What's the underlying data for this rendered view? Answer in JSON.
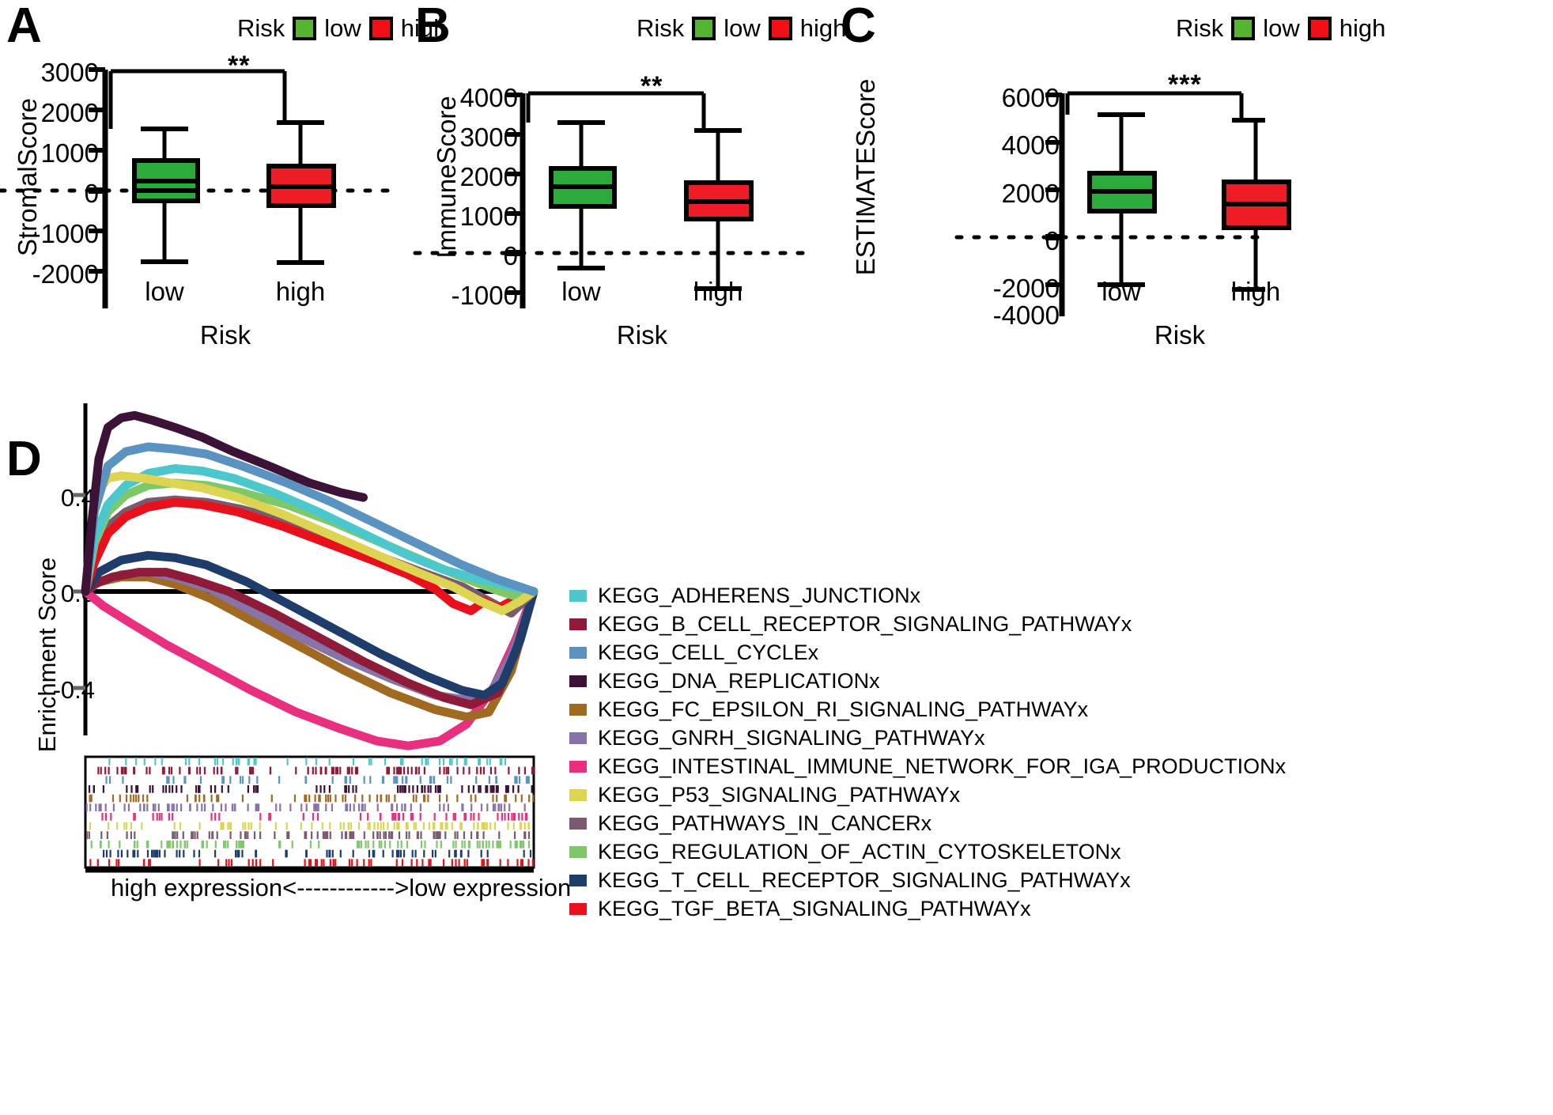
{
  "figure": {
    "panel_letters": [
      "A",
      "B",
      "C",
      "D"
    ]
  },
  "risk_legend": {
    "title": "Risk",
    "items": [
      {
        "label": "low",
        "color": "#55b531"
      },
      {
        "label": "high",
        "color": "#f20f16"
      }
    ]
  },
  "chart_data": [
    {
      "type": "box",
      "panel": "A",
      "title": "",
      "ylabel": "StromalScore",
      "xlabel": "Risk",
      "categories": [
        "low",
        "high"
      ],
      "yticks": [
        3000,
        2000,
        1000,
        0,
        -1000,
        -2000
      ],
      "ylim": [
        -2000,
        3000
      ],
      "significance": "**",
      "zero_reference_line": 0,
      "series": [
        {
          "name": "low",
          "color": "#2caa3c",
          "min": -1730,
          "q1": -20,
          "median": 230,
          "q3": 750,
          "max": 1990
        },
        {
          "name": "high",
          "color": "#ee1c25",
          "min": -1780,
          "q1": -380,
          "median": 110,
          "q3": 600,
          "max": 2080
        }
      ]
    },
    {
      "type": "box",
      "panel": "B",
      "title": "",
      "ylabel": "ImmuneScore",
      "xlabel": "Risk",
      "categories": [
        "low",
        "high"
      ],
      "yticks": [
        4000,
        3000,
        2000,
        1000,
        0,
        -1000
      ],
      "ylim": [
        -1000,
        4000
      ],
      "significance": "**",
      "zero_reference_line": 0,
      "series": [
        {
          "name": "low",
          "color": "#2caa3c",
          "min": -380,
          "q1": 1180,
          "median": 1680,
          "q3": 2130,
          "max": 3220
        },
        {
          "name": "high",
          "color": "#ee1c25",
          "min": -900,
          "q1": 860,
          "median": 1300,
          "q3": 1780,
          "max": 2900
        }
      ]
    },
    {
      "type": "box",
      "panel": "C",
      "title": "",
      "ylabel": "ESTIMATEScore",
      "xlabel": "Risk",
      "categories": [
        "low",
        "high"
      ],
      "yticks": [
        6000,
        4000,
        2000,
        0,
        -2000,
        -4000
      ],
      "ylim": [
        -4000,
        6000
      ],
      "significance": "***",
      "zero_reference_line": 0,
      "series": [
        {
          "name": "low",
          "color": "#2caa3c",
          "min": -2130,
          "q1": 1120,
          "median": 1950,
          "q3": 2700,
          "max": 4900
        },
        {
          "name": "high",
          "color": "#ee1c25",
          "min": -2320,
          "q1": 420,
          "median": 1420,
          "q3": 2320,
          "max": 4650
        }
      ]
    },
    {
      "type": "line",
      "panel": "D",
      "title": "",
      "ylabel": "Enrichment Score",
      "xlabel": "",
      "yticks": [
        0.4,
        0.0,
        -0.4
      ],
      "ytick_labels": [
        "0.4",
        "0.0",
        "-0.4"
      ],
      "ylim": [
        -0.72,
        0.78
      ],
      "xlim": [
        0,
        1
      ],
      "x_axis_caption": "high expression<------------>low expression",
      "legend_position": "right",
      "series": [
        {
          "name": "KEGG_ADHERENS_JUNCTIONx",
          "color": "#4cc8cd",
          "points": [
            [
              0.0,
              0.0
            ],
            [
              0.02,
              0.22
            ],
            [
              0.05,
              0.36
            ],
            [
              0.09,
              0.44
            ],
            [
              0.14,
              0.49
            ],
            [
              0.2,
              0.51
            ],
            [
              0.26,
              0.5
            ],
            [
              0.33,
              0.47
            ],
            [
              0.42,
              0.41
            ],
            [
              0.52,
              0.33
            ],
            [
              0.62,
              0.24
            ],
            [
              0.72,
              0.15
            ],
            [
              0.8,
              0.09
            ],
            [
              0.88,
              0.05
            ],
            [
              0.95,
              0.02
            ],
            [
              1.0,
              0.0
            ]
          ]
        },
        {
          "name": "KEGG_B_CELL_RECEPTOR_SIGNALING_PATHWAYx",
          "color": "#8e1c38",
          "points": [
            [
              0.0,
              0.0
            ],
            [
              0.02,
              0.03
            ],
            [
              0.06,
              0.06
            ],
            [
              0.12,
              0.08
            ],
            [
              0.18,
              0.08
            ],
            [
              0.24,
              0.05
            ],
            [
              0.32,
              0.0
            ],
            [
              0.42,
              -0.09
            ],
            [
              0.52,
              -0.19
            ],
            [
              0.62,
              -0.29
            ],
            [
              0.72,
              -0.38
            ],
            [
              0.8,
              -0.44
            ],
            [
              0.86,
              -0.47
            ],
            [
              0.92,
              -0.42
            ],
            [
              0.96,
              -0.25
            ],
            [
              1.0,
              0.0
            ]
          ]
        },
        {
          "name": "KEGG_CELL_CYCLEx",
          "color": "#5a93c0",
          "points": [
            [
              0.0,
              0.0
            ],
            [
              0.02,
              0.33
            ],
            [
              0.05,
              0.52
            ],
            [
              0.09,
              0.58
            ],
            [
              0.14,
              0.6
            ],
            [
              0.2,
              0.59
            ],
            [
              0.27,
              0.57
            ],
            [
              0.35,
              0.52
            ],
            [
              0.45,
              0.45
            ],
            [
              0.55,
              0.37
            ],
            [
              0.65,
              0.28
            ],
            [
              0.75,
              0.19
            ],
            [
              0.84,
              0.11
            ],
            [
              0.92,
              0.05
            ],
            [
              1.0,
              0.0
            ]
          ]
        },
        {
          "name": "KEGG_DNA_REPLICATIONx",
          "color": "#3c1236",
          "points": [
            [
              0.0,
              0.0
            ],
            [
              0.015,
              0.3
            ],
            [
              0.03,
              0.55
            ],
            [
              0.05,
              0.68
            ],
            [
              0.08,
              0.72
            ],
            [
              0.11,
              0.73
            ],
            [
              0.15,
              0.71
            ],
            [
              0.2,
              0.68
            ],
            [
              0.26,
              0.64
            ],
            [
              0.33,
              0.58
            ],
            [
              0.41,
              0.52
            ],
            [
              0.5,
              0.45
            ],
            [
              0.57,
              0.41
            ],
            [
              0.62,
              0.39
            ]
          ]
        },
        {
          "name": "KEGG_FC_EPSILON_RI_SIGNALING_PATHWAYx",
          "color": "#a06a23",
          "points": [
            [
              0.0,
              0.0
            ],
            [
              0.03,
              0.04
            ],
            [
              0.08,
              0.06
            ],
            [
              0.14,
              0.06
            ],
            [
              0.2,
              0.03
            ],
            [
              0.28,
              -0.03
            ],
            [
              0.38,
              -0.13
            ],
            [
              0.48,
              -0.23
            ],
            [
              0.58,
              -0.33
            ],
            [
              0.68,
              -0.42
            ],
            [
              0.78,
              -0.49
            ],
            [
              0.85,
              -0.52
            ],
            [
              0.9,
              -0.5
            ],
            [
              0.95,
              -0.33
            ],
            [
              1.0,
              0.0
            ]
          ]
        },
        {
          "name": "KEGG_GNRH_SIGNALING_PATHWAYx",
          "color": "#8873a8",
          "points": [
            [
              0.0,
              0.0
            ],
            [
              0.03,
              0.04
            ],
            [
              0.08,
              0.07
            ],
            [
              0.14,
              0.08
            ],
            [
              0.2,
              0.06
            ],
            [
              0.28,
              0.01
            ],
            [
              0.38,
              -0.09
            ],
            [
              0.48,
              -0.19
            ],
            [
              0.58,
              -0.28
            ],
            [
              0.68,
              -0.36
            ],
            [
              0.78,
              -0.43
            ],
            [
              0.85,
              -0.45
            ],
            [
              0.9,
              -0.43
            ],
            [
              0.95,
              -0.27
            ],
            [
              1.0,
              0.0
            ]
          ]
        },
        {
          "name": "KEGG_INTESTINAL_IMMUNE_NETWORK_FOR_IGA_PRODUCTIONx",
          "color": "#e8307f",
          "points": [
            [
              0.0,
              0.0
            ],
            [
              0.04,
              -0.06
            ],
            [
              0.1,
              -0.13
            ],
            [
              0.18,
              -0.22
            ],
            [
              0.27,
              -0.31
            ],
            [
              0.37,
              -0.41
            ],
            [
              0.47,
              -0.5
            ],
            [
              0.57,
              -0.57
            ],
            [
              0.65,
              -0.62
            ],
            [
              0.72,
              -0.64
            ],
            [
              0.79,
              -0.62
            ],
            [
              0.85,
              -0.55
            ],
            [
              0.91,
              -0.4
            ],
            [
              0.96,
              -0.2
            ],
            [
              1.0,
              0.0
            ]
          ]
        },
        {
          "name": "KEGG_P53_SIGNALING_PATHWAYx",
          "color": "#ddd452",
          "points": [
            [
              0.0,
              0.0
            ],
            [
              0.015,
              0.28
            ],
            [
              0.03,
              0.42
            ],
            [
              0.05,
              0.47
            ],
            [
              0.08,
              0.48
            ],
            [
              0.13,
              0.47
            ],
            [
              0.19,
              0.45
            ],
            [
              0.26,
              0.43
            ],
            [
              0.34,
              0.39
            ],
            [
              0.44,
              0.32
            ],
            [
              0.54,
              0.24
            ],
            [
              0.64,
              0.16
            ],
            [
              0.74,
              0.08
            ],
            [
              0.82,
              0.02
            ],
            [
              0.88,
              -0.04
            ],
            [
              0.93,
              -0.08
            ],
            [
              0.97,
              -0.04
            ],
            [
              1.0,
              0.0
            ]
          ]
        },
        {
          "name": "KEGG_PATHWAYS_IN_CANCERx",
          "color": "#7a5a6e",
          "points": [
            [
              0.0,
              0.0
            ],
            [
              0.02,
              0.16
            ],
            [
              0.05,
              0.27
            ],
            [
              0.09,
              0.33
            ],
            [
              0.14,
              0.37
            ],
            [
              0.2,
              0.38
            ],
            [
              0.27,
              0.37
            ],
            [
              0.35,
              0.34
            ],
            [
              0.45,
              0.29
            ],
            [
              0.55,
              0.22
            ],
            [
              0.65,
              0.15
            ],
            [
              0.75,
              0.08
            ],
            [
              0.84,
              0.02
            ],
            [
              0.9,
              -0.04
            ],
            [
              0.95,
              -0.09
            ],
            [
              1.0,
              0.0
            ]
          ]
        },
        {
          "name": "KEGG_REGULATION_OF_ACTIN_CYTOSKELETONx",
          "color": "#7ec86a",
          "points": [
            [
              0.0,
              0.0
            ],
            [
              0.02,
              0.2
            ],
            [
              0.05,
              0.33
            ],
            [
              0.09,
              0.4
            ],
            [
              0.14,
              0.44
            ],
            [
              0.2,
              0.45
            ],
            [
              0.27,
              0.44
            ],
            [
              0.35,
              0.41
            ],
            [
              0.45,
              0.36
            ],
            [
              0.55,
              0.29
            ],
            [
              0.65,
              0.21
            ],
            [
              0.75,
              0.13
            ],
            [
              0.84,
              0.06
            ],
            [
              0.91,
              0.01
            ],
            [
              0.96,
              -0.02
            ],
            [
              1.0,
              0.0
            ]
          ]
        },
        {
          "name": "KEGG_T_CELL_RECEPTOR_SIGNALING_PATHWAYx",
          "color": "#1f3d6b",
          "points": [
            [
              0.0,
              0.0
            ],
            [
              0.03,
              0.08
            ],
            [
              0.08,
              0.13
            ],
            [
              0.14,
              0.15
            ],
            [
              0.2,
              0.14
            ],
            [
              0.27,
              0.11
            ],
            [
              0.36,
              0.04
            ],
            [
              0.46,
              -0.06
            ],
            [
              0.56,
              -0.16
            ],
            [
              0.66,
              -0.26
            ],
            [
              0.76,
              -0.35
            ],
            [
              0.84,
              -0.41
            ],
            [
              0.89,
              -0.43
            ],
            [
              0.93,
              -0.38
            ],
            [
              0.97,
              -0.2
            ],
            [
              1.0,
              0.0
            ]
          ]
        },
        {
          "name": "KEGG_TGF_BETA_SIGNALING_PATHWAYx",
          "color": "#e8111b",
          "points": [
            [
              0.0,
              0.0
            ],
            [
              0.02,
              0.12
            ],
            [
              0.05,
              0.24
            ],
            [
              0.09,
              0.31
            ],
            [
              0.14,
              0.35
            ],
            [
              0.2,
              0.37
            ],
            [
              0.26,
              0.36
            ],
            [
              0.34,
              0.33
            ],
            [
              0.44,
              0.27
            ],
            [
              0.54,
              0.2
            ],
            [
              0.64,
              0.13
            ],
            [
              0.72,
              0.07
            ],
            [
              0.78,
              0.01
            ],
            [
              0.82,
              -0.05
            ],
            [
              0.86,
              -0.08
            ],
            [
              0.89,
              -0.04
            ],
            [
              0.92,
              -0.07
            ],
            [
              0.96,
              -0.03
            ],
            [
              1.0,
              0.0
            ]
          ]
        }
      ]
    }
  ]
}
